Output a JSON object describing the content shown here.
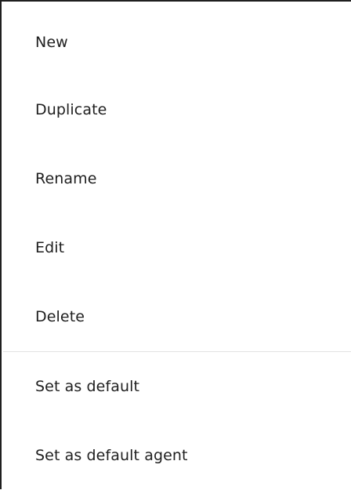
{
  "context_menu": {
    "primary_items": [
      {
        "label": "New"
      },
      {
        "label": "Duplicate"
      },
      {
        "label": "Rename"
      },
      {
        "label": "Edit"
      },
      {
        "label": "Delete"
      }
    ],
    "secondary_items": [
      {
        "label": "Set as default"
      },
      {
        "label": "Set as default agent"
      }
    ]
  }
}
